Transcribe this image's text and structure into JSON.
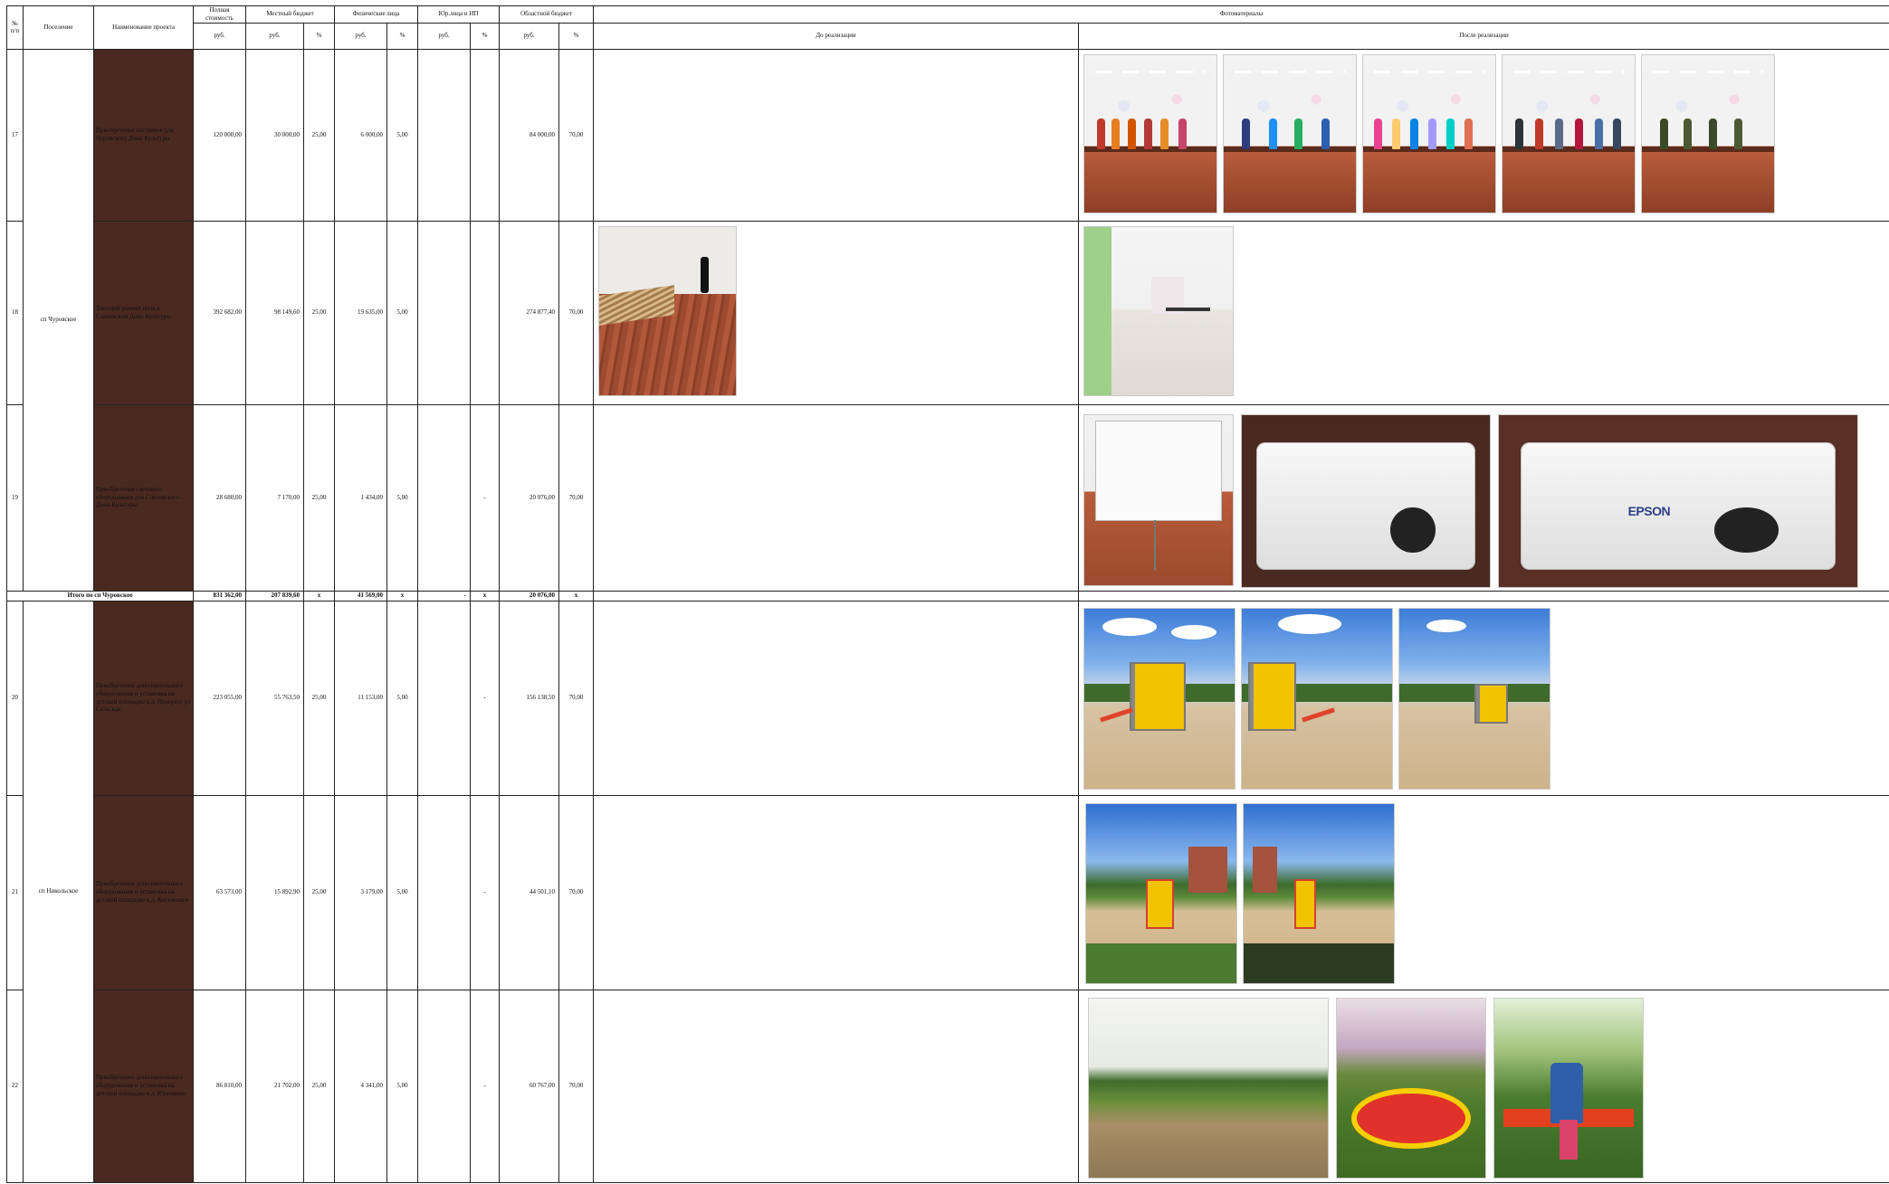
{
  "headers": {
    "num": "№ п/п",
    "settlement": "Поселение",
    "project": "Наименование проекта",
    "full_cost": "Полная стоимость",
    "local_budget": "Местный бюджет",
    "individuals": "Физические лица",
    "legal": "Юр.лица и ИП",
    "regional": "Областной бюджет",
    "photos": "Фотоматериалы",
    "rub": "руб.",
    "pct": "%",
    "before": "До реализации",
    "after": "После реализации"
  },
  "settlements": {
    "churovskoe": "сп Чуровское",
    "nikolskoe": "сп Никольское"
  },
  "rows": [
    {
      "n": "17",
      "project": "Приобретение  костюмов для Чуровского  Дома Культуры",
      "full": "120 000,00",
      "local": "30 000,00",
      "local_pct": "25,00",
      "ind": "6 000,00",
      "ind_pct": "5,00",
      "legal": "",
      "legal_pct": "",
      "reg": "84 000,00",
      "reg_pct": "70,00"
    },
    {
      "n": "18",
      "project": "Текущий ремонт пола в Слизовском  Доме Культуры",
      "full": "392 682,00",
      "local": "98 149,60",
      "local_pct": "25,00",
      "ind": "19 635,00",
      "ind_pct": "5,00",
      "legal": "",
      "legal_pct": "",
      "reg": "274 877,40",
      "reg_pct": "70,00"
    },
    {
      "n": "19",
      "project": "Приобретение светового оборудования для Слизовского Дома Культуры",
      "full": "28 680,00",
      "local": "7 170,00",
      "local_pct": "25,00",
      "ind": "1 434,00",
      "ind_pct": "5,00",
      "legal": "",
      "legal_pct": "-",
      "reg": "20 076,00",
      "reg_pct": "70,00"
    },
    {
      "n": "20",
      "project": "Приобретение дополнительного оборудования  и установка на детской площадке в д. Прогресс ул Сельская",
      "full": "223 055,00",
      "local": "55 763,50",
      "local_pct": "25,00",
      "ind": "11 153,00",
      "ind_pct": "5,00",
      "legal": "",
      "legal_pct": "-",
      "reg": "156 138,50",
      "reg_pct": "70,00"
    },
    {
      "n": "21",
      "project": "Приобретение дополнительного оборудования и установка  на детской  площадке в д. Костинское",
      "full": "63 573,00",
      "local": "15 892,90",
      "local_pct": "25,00",
      "ind": "3 179,00",
      "ind_pct": "5,00",
      "legal": "",
      "legal_pct": "-",
      "reg": "44 501,10",
      "reg_pct": "70,00"
    },
    {
      "n": "22",
      "project": "Приобретение дополнительного оборудования и установка  на детской  площадке в д. Юрочкино",
      "full": "86 810,00",
      "local": "21 702,00",
      "local_pct": "25,00",
      "ind": "4 341,00",
      "ind_pct": "5,00",
      "legal": "",
      "legal_pct": "-",
      "reg": "60 767,00",
      "reg_pct": "70,00"
    }
  ],
  "total": {
    "label": "Итого по сп Чуровское",
    "full": "831 362,00",
    "local": "207 839,60",
    "local_pct": "x",
    "ind": "41 569,00",
    "ind_pct": "x",
    "legal": "-",
    "legal_pct": "x",
    "reg": "20 076,00",
    "reg_pct": "x"
  },
  "photo_text": {
    "brand": "EPSON"
  }
}
